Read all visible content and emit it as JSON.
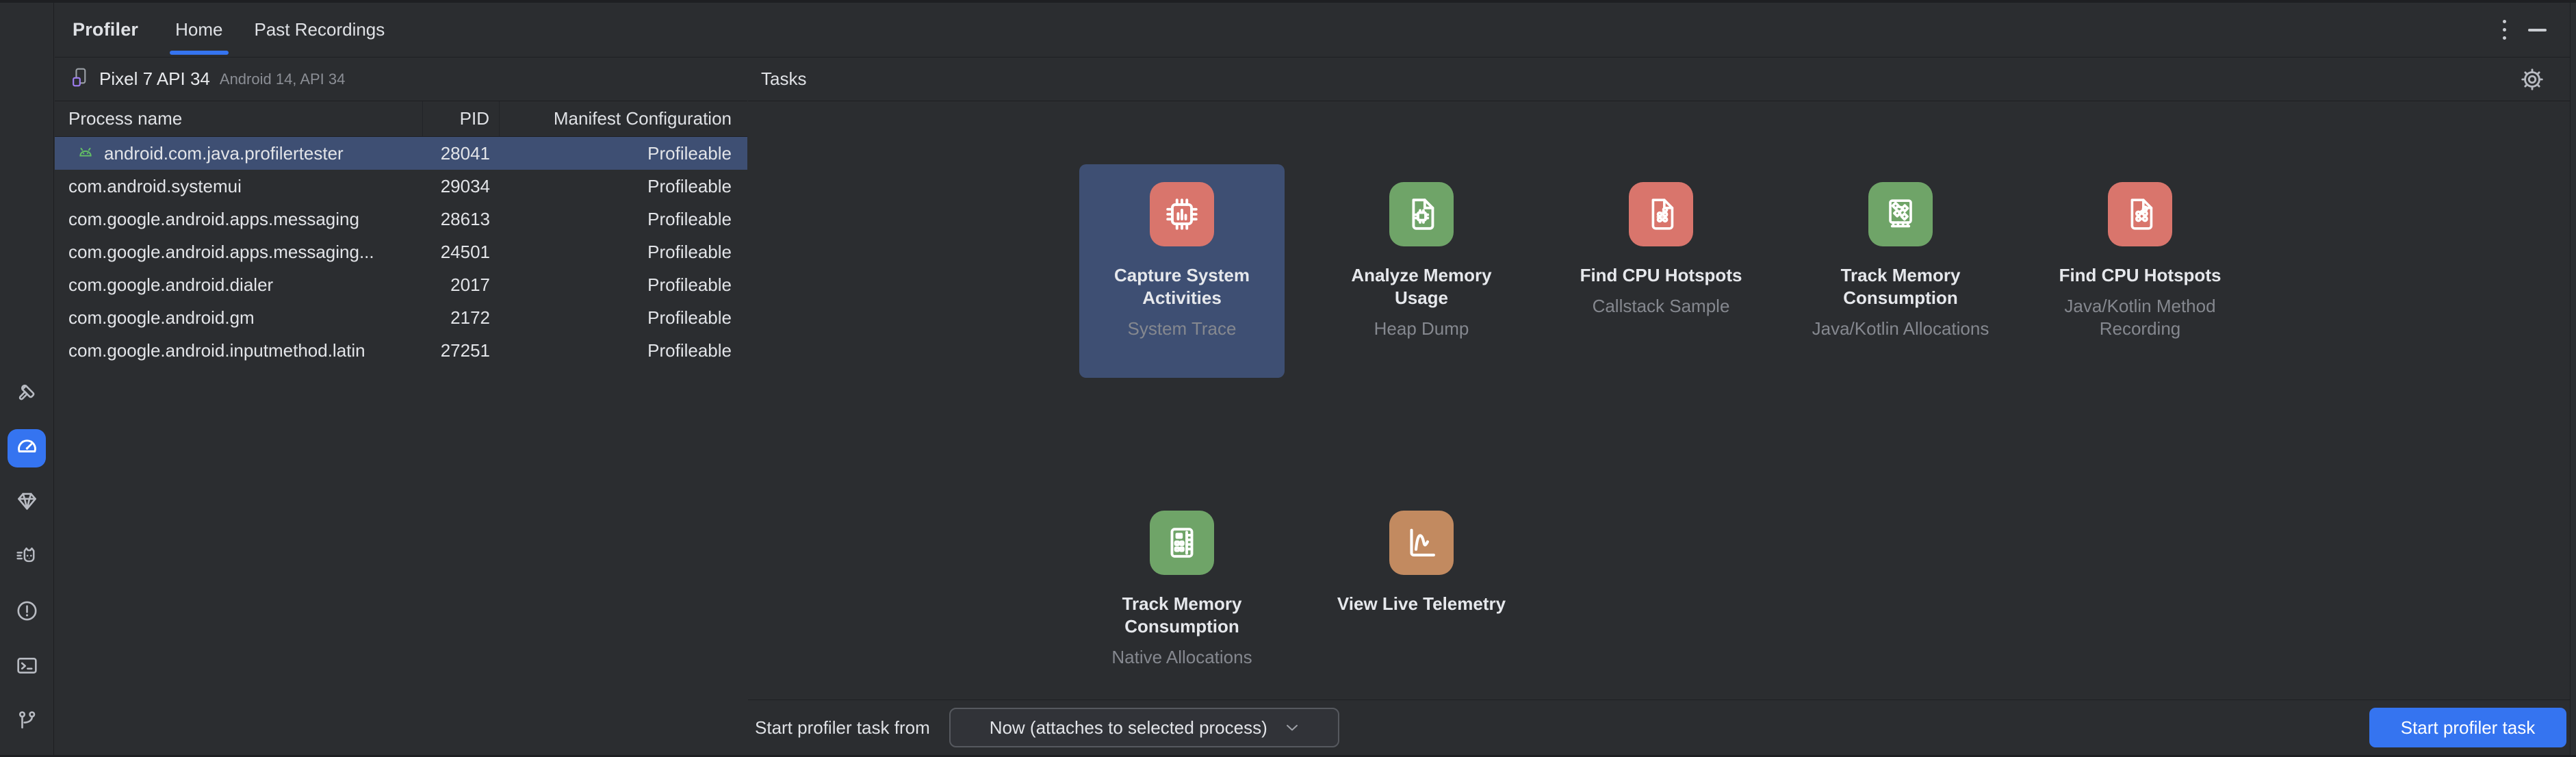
{
  "header": {
    "title": "Profiler",
    "tabs": [
      {
        "label": "Home"
      },
      {
        "label": "Past Recordings"
      }
    ],
    "active_tab": "Home"
  },
  "sidebar": {
    "selected": "profiler",
    "icons": [
      "build-hammer",
      "profiler-gauge",
      "app-quality-insights-gem",
      "logcat-cat",
      "problems-exclamation",
      "terminal",
      "version-control-branch"
    ]
  },
  "device": {
    "name": "Pixel 7 API 34",
    "os": "Android 14, API 34"
  },
  "process_table": {
    "columns": [
      "Process name",
      "PID",
      "Manifest Configuration"
    ],
    "selected_row": 0,
    "rows": [
      {
        "name": "android.com.java.profilertester",
        "pid": "28041",
        "manifest": "Profileable"
      },
      {
        "name": "com.android.systemui",
        "pid": "29034",
        "manifest": "Profileable"
      },
      {
        "name": "com.google.android.apps.messaging",
        "pid": "28613",
        "manifest": "Profileable"
      },
      {
        "name": "com.google.android.apps.messaging...",
        "pid": "24501",
        "manifest": "Profileable"
      },
      {
        "name": "com.google.android.dialer",
        "pid": "2017",
        "manifest": "Profileable"
      },
      {
        "name": "com.google.android.gm",
        "pid": "2172",
        "manifest": "Profileable"
      },
      {
        "name": "com.google.android.inputmethod.latin",
        "pid": "27251",
        "manifest": "Profileable"
      }
    ]
  },
  "tasks": {
    "title": "Tasks",
    "selected_card": 0,
    "cards": [
      {
        "title": "Capture System Activities",
        "subtitle": "System Trace",
        "icon": "cpu-chip-trace",
        "color": "#D9756C"
      },
      {
        "title": "Analyze Memory Usage",
        "subtitle": "Heap Dump",
        "icon": "document-chip",
        "color": "#6FA468"
      },
      {
        "title": "Find CPU Hotspots",
        "subtitle": "Callstack Sample",
        "icon": "document-callstack-dots",
        "color": "#D9756C"
      },
      {
        "title": "Track Memory Consumption",
        "subtitle": "Java/Kotlin Allocations",
        "icon": "memory-diamond-board",
        "color": "#6FA468"
      },
      {
        "title": "Find CPU Hotspots",
        "subtitle": "Java/Kotlin Method Recording",
        "icon": "document-method-graph",
        "color": "#D9756C"
      },
      {
        "title": "Track Memory Consumption",
        "subtitle": "Native Allocations",
        "icon": "ram-stick",
        "color": "#6FA468"
      },
      {
        "title": "View Live Telemetry",
        "subtitle": "",
        "icon": "line-chart",
        "color": "#C28A60"
      }
    ]
  },
  "footer": {
    "label": "Start profiler task from",
    "recording_type_value": "Now (attaches to selected process)",
    "start_button_label": "Start profiler task"
  },
  "colors": {
    "accent": "#3574F0",
    "selection": "#3E4F73",
    "task_red": "#D9756C",
    "task_green": "#6FA468",
    "task_orange": "#C28A60"
  }
}
